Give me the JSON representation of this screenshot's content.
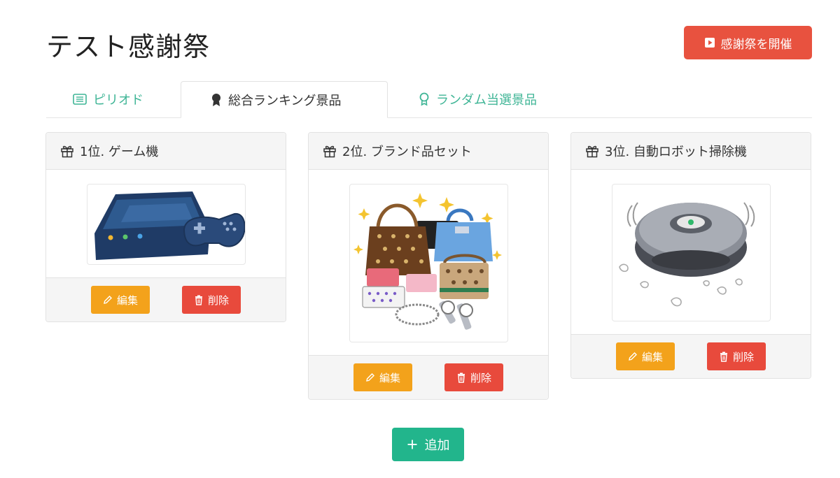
{
  "page": {
    "title": "テスト感謝祭"
  },
  "header": {
    "start_button_label": "感謝祭を開催"
  },
  "tabs": [
    {
      "label": "ピリオド",
      "icon": "list-icon",
      "active": false
    },
    {
      "label": "総合ランキング景品",
      "icon": "medal-icon",
      "active": true
    },
    {
      "label": "ランダム当選景品",
      "icon": "award-icon",
      "active": false
    }
  ],
  "prizes": [
    {
      "title": "1位. ゲーム機",
      "image": "game-console-illustration",
      "edit_label": "編集",
      "delete_label": "削除"
    },
    {
      "title": "2位. ブランド品セット",
      "image": "brand-goods-illustration",
      "edit_label": "編集",
      "delete_label": "削除"
    },
    {
      "title": "3位. 自動ロボット掃除機",
      "image": "robot-vacuum-illustration",
      "edit_label": "編集",
      "delete_label": "削除"
    }
  ],
  "add_button_label": "追加",
  "colors": {
    "accent_green": "#3fb596",
    "danger_red": "#e84a3c",
    "warning_orange": "#f3a21b",
    "add_green": "#22b58c"
  }
}
